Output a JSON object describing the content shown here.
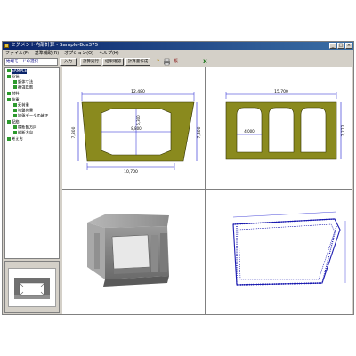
{
  "window": {
    "title": "セグメント内部計算 - Sample-Box375"
  },
  "menu": [
    "ファイル(F)",
    "基準補助(R)",
    "オプション(O)",
    "ヘルプ(H)"
  ],
  "toolbar": {
    "combo_value": "始端モードの選択",
    "buttons": [
      "入力",
      "計算実行",
      "結果確認",
      "計算書作成"
    ],
    "icons": [
      "help-icon",
      "print-icon",
      "label-icon",
      "excel-icon"
    ],
    "label_icon_text": "帳",
    "excel_icon_text": "X"
  },
  "tree": [
    {
      "label": "SAMPLE",
      "level": 0,
      "selected": true
    },
    {
      "label": "形状",
      "level": 0
    },
    {
      "label": "躯体寸法",
      "level": 1
    },
    {
      "label": "補強鉄筋",
      "level": 1
    },
    {
      "label": "材料",
      "level": 0
    },
    {
      "label": "荷重",
      "level": 0
    },
    {
      "label": "死荷重",
      "level": 1
    },
    {
      "label": "地盤荷重",
      "level": 1
    },
    {
      "label": "地盤データの補正",
      "level": 1
    },
    {
      "label": "配筋",
      "level": 0
    },
    {
      "label": "横断軸方向",
      "level": 1
    },
    {
      "label": "縦断方向",
      "level": 1
    },
    {
      "label": "考え方",
      "level": 0
    }
  ],
  "drawings": {
    "single_box": {
      "top_dim": "12,480",
      "bottom_dim": "10,700",
      "left_dim": "7,800",
      "right_dim": "7,800",
      "inner_width": "8,800",
      "inner_height": "6,300"
    },
    "triple_box": {
      "top_dim": "15,700",
      "right_dim": "7,772",
      "cell_width": "4,000"
    }
  },
  "colors": {
    "concrete_fill": "#8a8a1e",
    "dim_line": "#1a1ad0",
    "title_bar": "#0a246a",
    "tree_box": "#2e9a2e",
    "rebar": "#1a1ab0"
  }
}
